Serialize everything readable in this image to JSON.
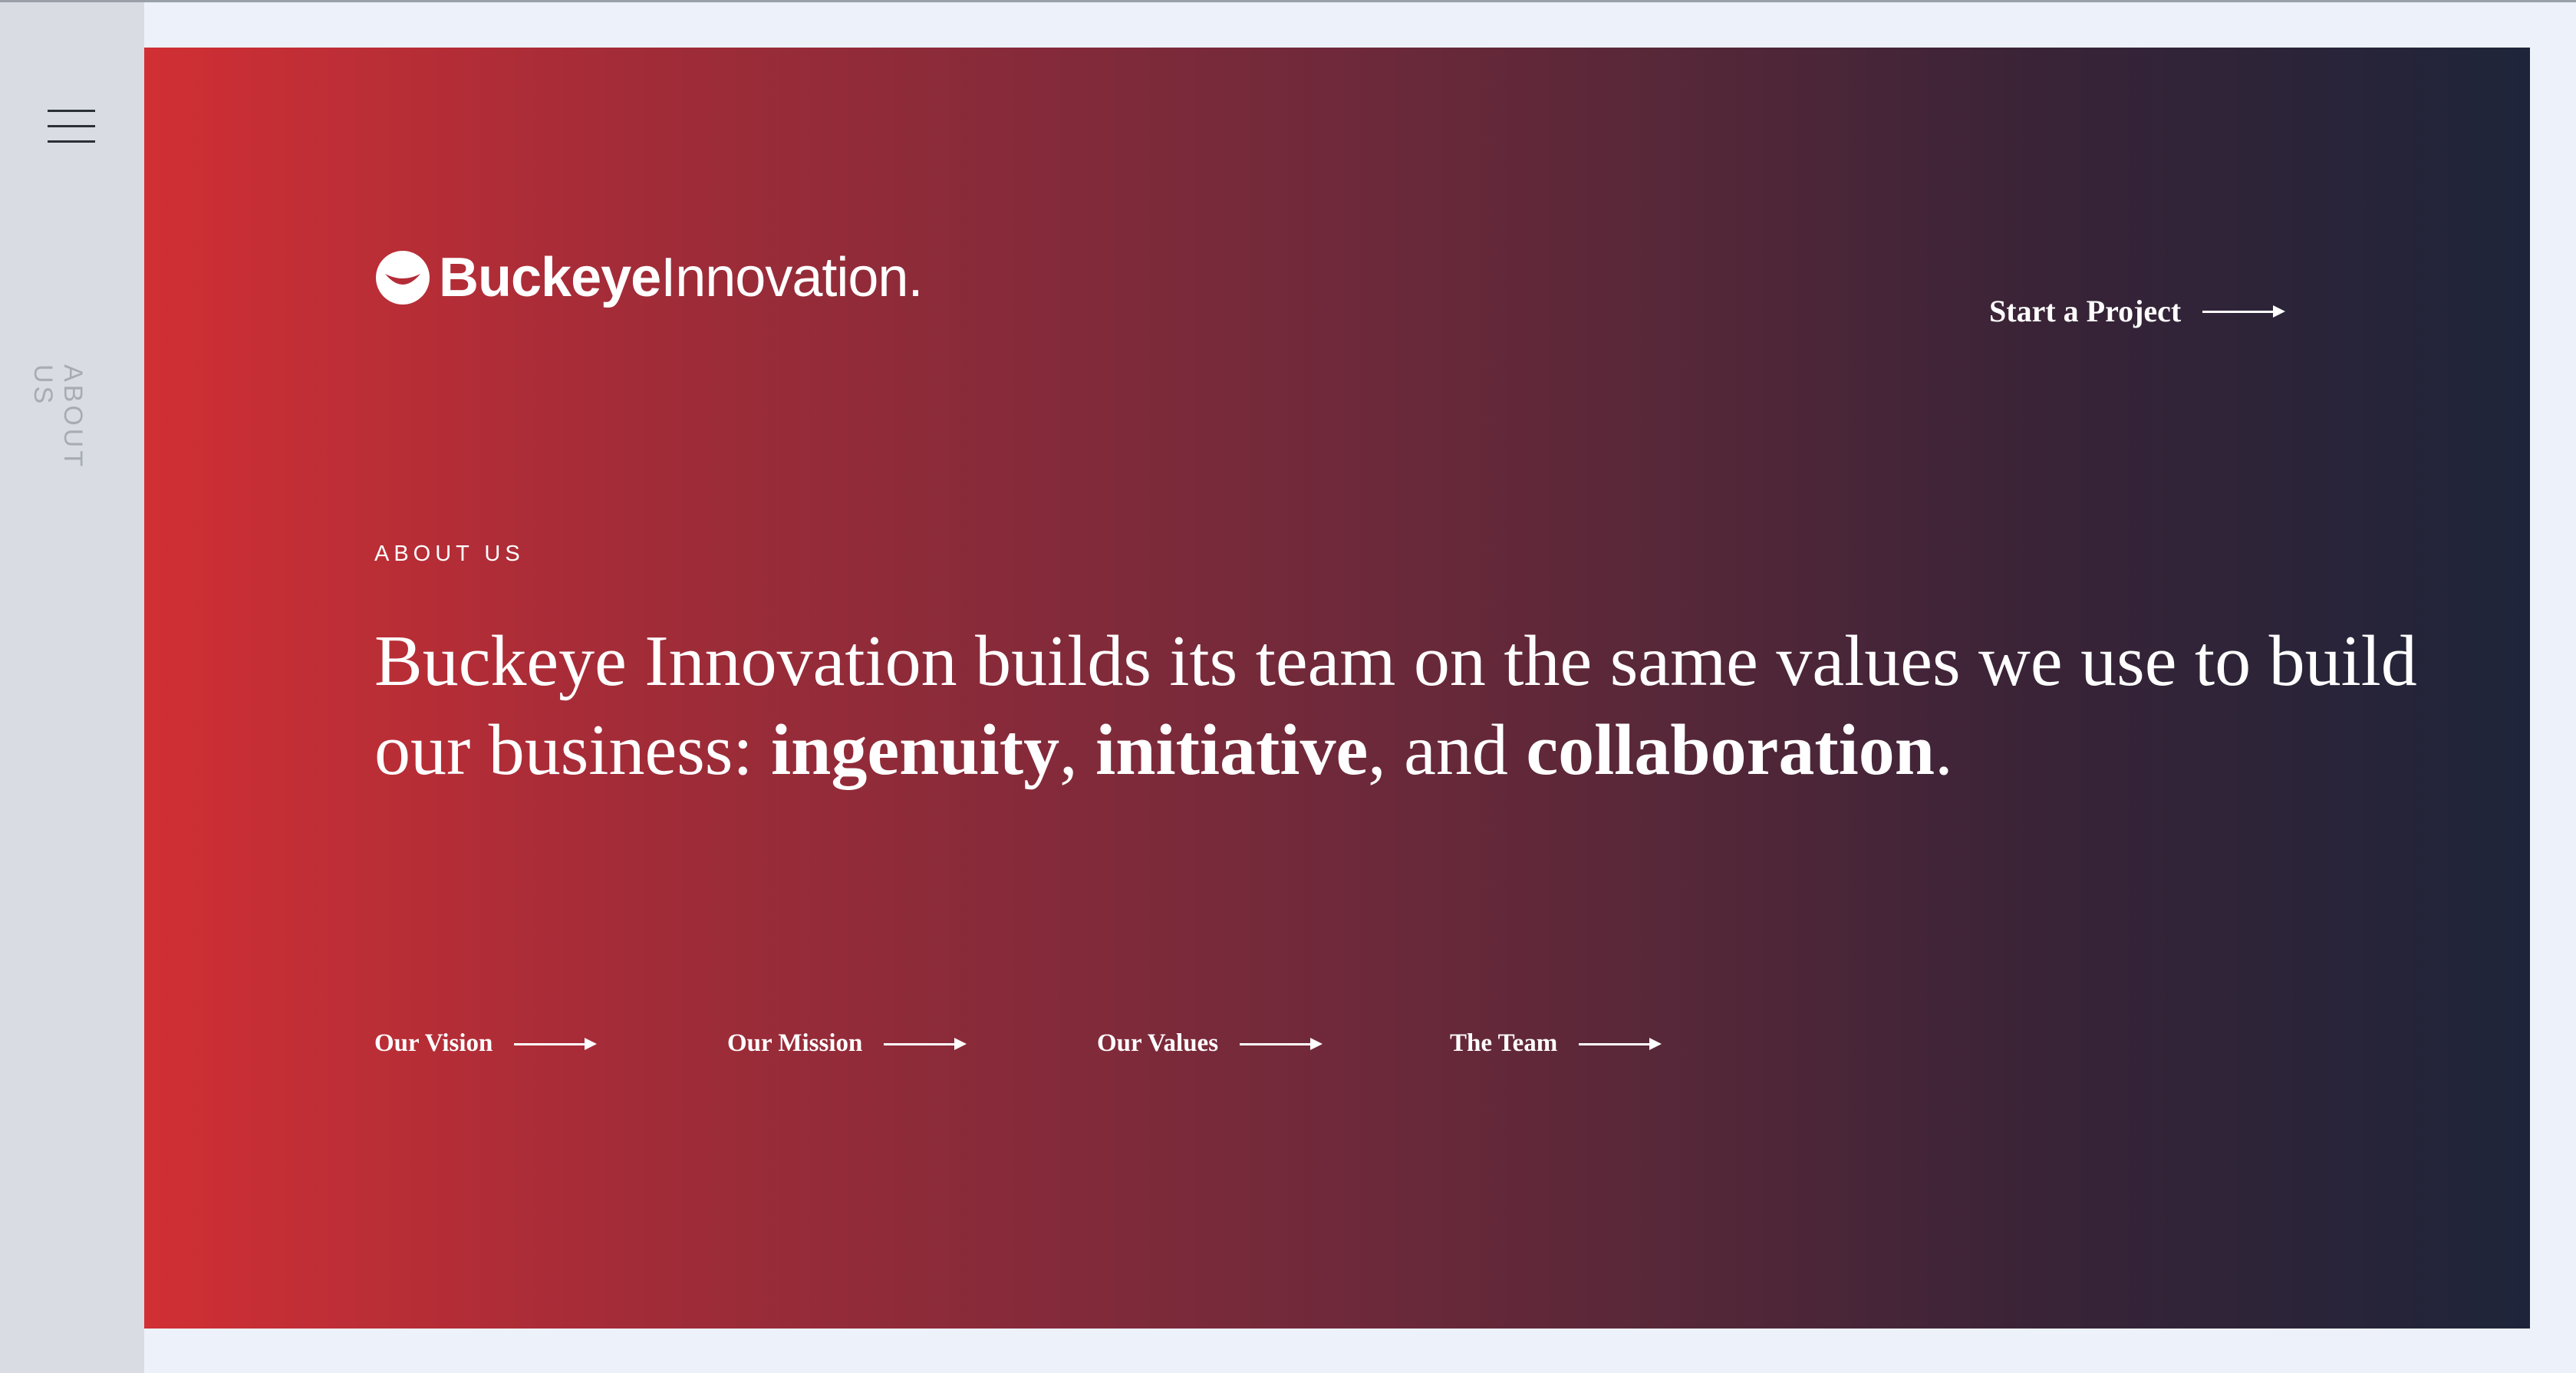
{
  "sidebar": {
    "menu_icon": "hamburger-menu-icon",
    "section_label": "ABOUT US"
  },
  "header": {
    "logo_icon": "buckeye-logo-icon",
    "logo_bold": "Buckeye",
    "logo_light": "Innovation.",
    "cta_label": "Start a Project",
    "cta_icon": "arrow-right-icon"
  },
  "hero": {
    "eyebrow": "ABOUT US",
    "headline_intro": "Buckeye Innovation builds its team on the same values we use to build our business: ",
    "value_1": "ingenuity",
    "sep_1": ", ",
    "value_2": "initiative",
    "sep_2": ", and ",
    "value_3": "collaboration",
    "end": "."
  },
  "links": [
    {
      "label": "Our Vision",
      "icon": "arrow-right-icon"
    },
    {
      "label": "Our Mission",
      "icon": "arrow-right-icon"
    },
    {
      "label": "Our Values",
      "icon": "arrow-right-icon"
    },
    {
      "label": "The Team",
      "icon": "arrow-right-icon"
    }
  ],
  "colors": {
    "gradient_start": "#d12f34",
    "gradient_end": "#1e253a",
    "text": "#ffffff",
    "sidebar_bg": "#d9dde3",
    "page_bg": "#edf2fa"
  }
}
